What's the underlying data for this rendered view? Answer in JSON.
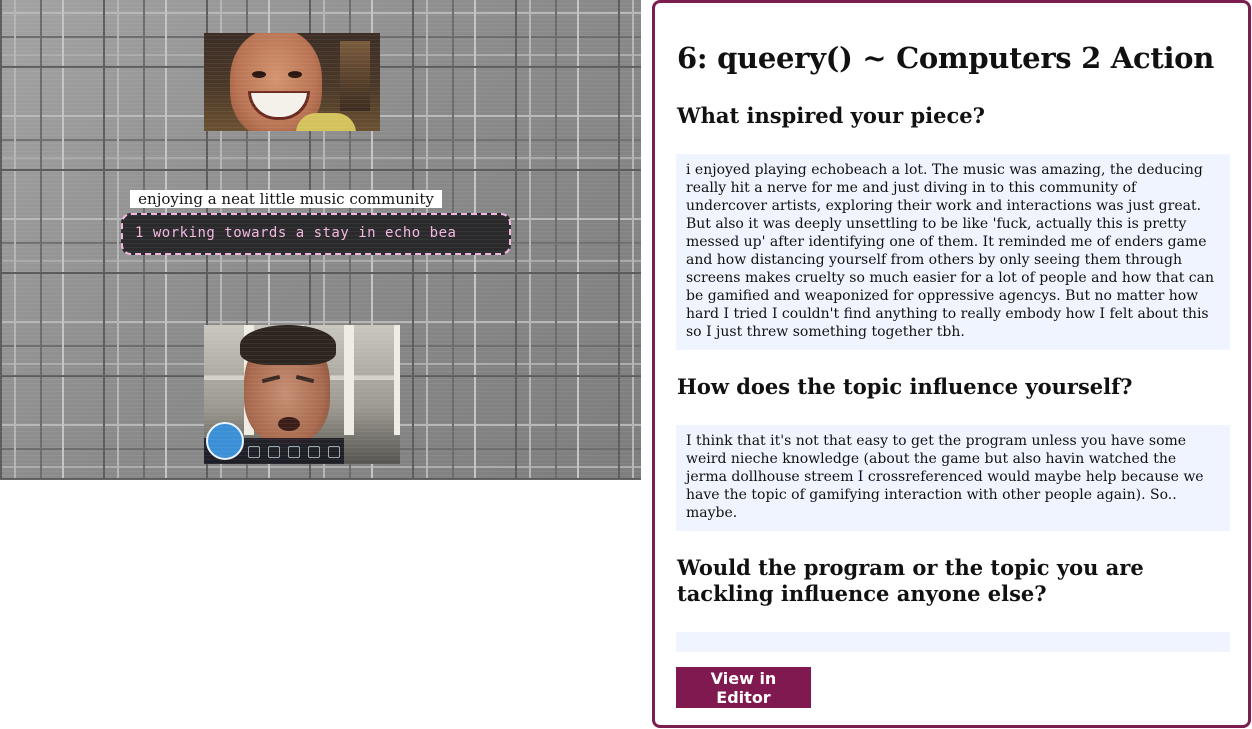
{
  "canvas": {
    "caption": "enjoying a neat little music community",
    "ticker_text": "1 working towards a stay in echo bea"
  },
  "panel": {
    "title": "6: queery() ~ Computers 2 Action",
    "questions": [
      {
        "heading": "What inspired your piece?",
        "answer": "i enjoyed playing echobeach a lot. The music was amazing, the deducing really hit a nerve for me and just diving in to this community of undercover artists, exploring their work and interactions was just great. But also it was deeply unsettling to be like 'fuck, actually this is pretty messed up' after identifying one of them. It reminded me of enders game and how distancing yourself from others by only seeing them through screens makes cruelty so much easier for a lot of people and how that can be gamified and weaponized for oppressive agencys. But no matter how hard I tried I couldn't find anything to really embody how I felt about this so I just threw something together tbh."
      },
      {
        "heading": "How does the topic influence yourself?",
        "answer": "I think that it's not that easy to get the program unless you have some weird nieche knowledge (about the game but also havin watched the jerma dollhouse streem I crossreferenced would maybe help because we have the topic of gamifying interaction with other people again). So.. maybe."
      },
      {
        "heading": "Would the program or the topic you are tackling influence anyone else?",
        "answer": ""
      }
    ],
    "view_button_label": "View in Editor"
  },
  "colors": {
    "accent": "#80194f",
    "panel_border": "#7d1e51",
    "answer_bg": "#eff4fe",
    "ticker_text": "#f3b6de"
  }
}
